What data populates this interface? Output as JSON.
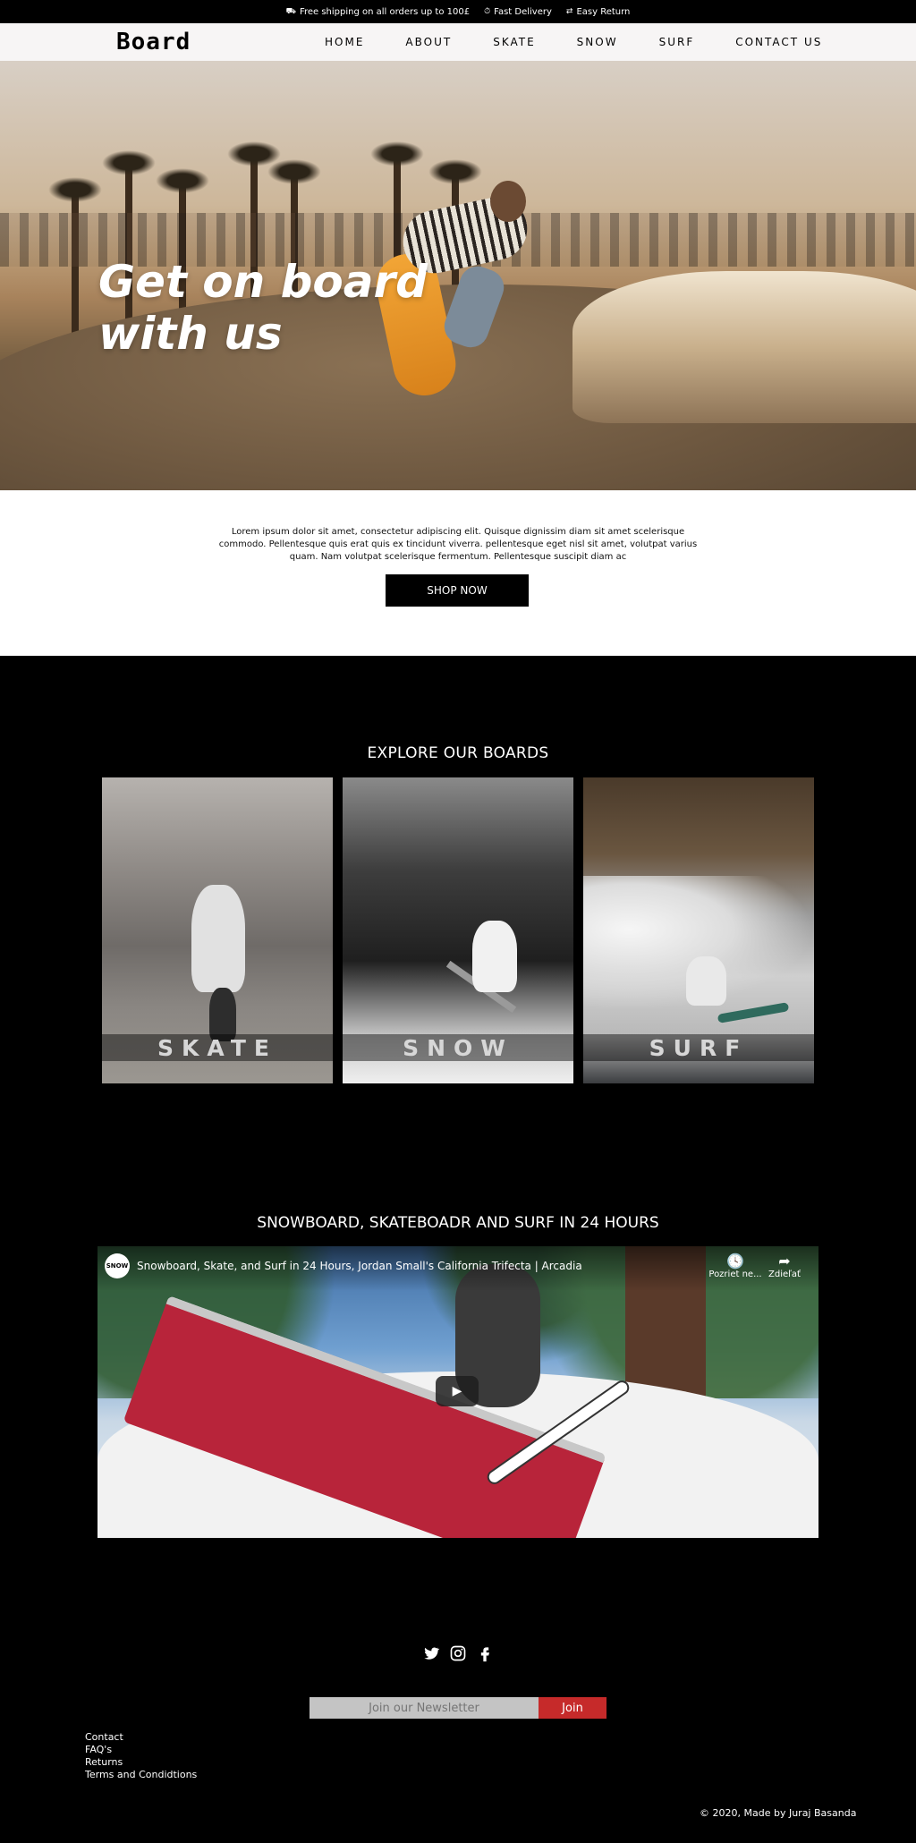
{
  "topbar": {
    "items": [
      {
        "icon": "truck-icon",
        "text": "Free shipping on all orders up to 100£"
      },
      {
        "icon": "clock-icon",
        "text": "Fast Delivery"
      },
      {
        "icon": "exchange-icon",
        "text": "Easy Return"
      }
    ]
  },
  "nav": {
    "logo": "Board",
    "menu": [
      "HOME",
      "ABOUT",
      "SKATE",
      "SNOW",
      "SURF",
      "CONTACT US"
    ]
  },
  "hero": {
    "title_line1": "Get on board",
    "title_line2": "with us"
  },
  "intro": {
    "text": "Lorem ipsum dolor sit amet, consectetur adipiscing elit. Quisque dignissim diam sit amet scelerisque commodo. Pellentesque quis erat quis ex tincidunt viverra. pellentesque eget nisl sit amet, volutpat varius quam. Nam volutpat scelerisque fermentum. Pellentesque suscipit diam ac",
    "button": "SHOP NOW"
  },
  "explore": {
    "title": "EXPLORE OUR BOARDS",
    "cards": [
      "SKATE",
      "SNOW",
      "SURF"
    ]
  },
  "video": {
    "section_title": "SNOWBOARD, SKATEBOADR AND SURF IN 24 HOURS",
    "channel_badge": "SNOW",
    "title": "Snowboard, Skate, and Surf in 24 Hours, Jordan Small's California Trifecta | Arcadia",
    "watch_later": "Pozriet ne...",
    "share": "Zdieľať"
  },
  "footer": {
    "social": [
      "twitter-icon",
      "instagram-icon",
      "facebook-icon"
    ],
    "newsletter_placeholder": "Join our Newsletter",
    "newsletter_button": "Join",
    "links": [
      "Contact",
      "FAQ's",
      "Returns",
      "Terms and Condidtions"
    ],
    "copyright": "© 2020, Made by Juraj Basanda"
  },
  "colors": {
    "accent_red": "#c62a2a",
    "nav_bg": "#f7f5f5",
    "page_bg": "#000000"
  }
}
